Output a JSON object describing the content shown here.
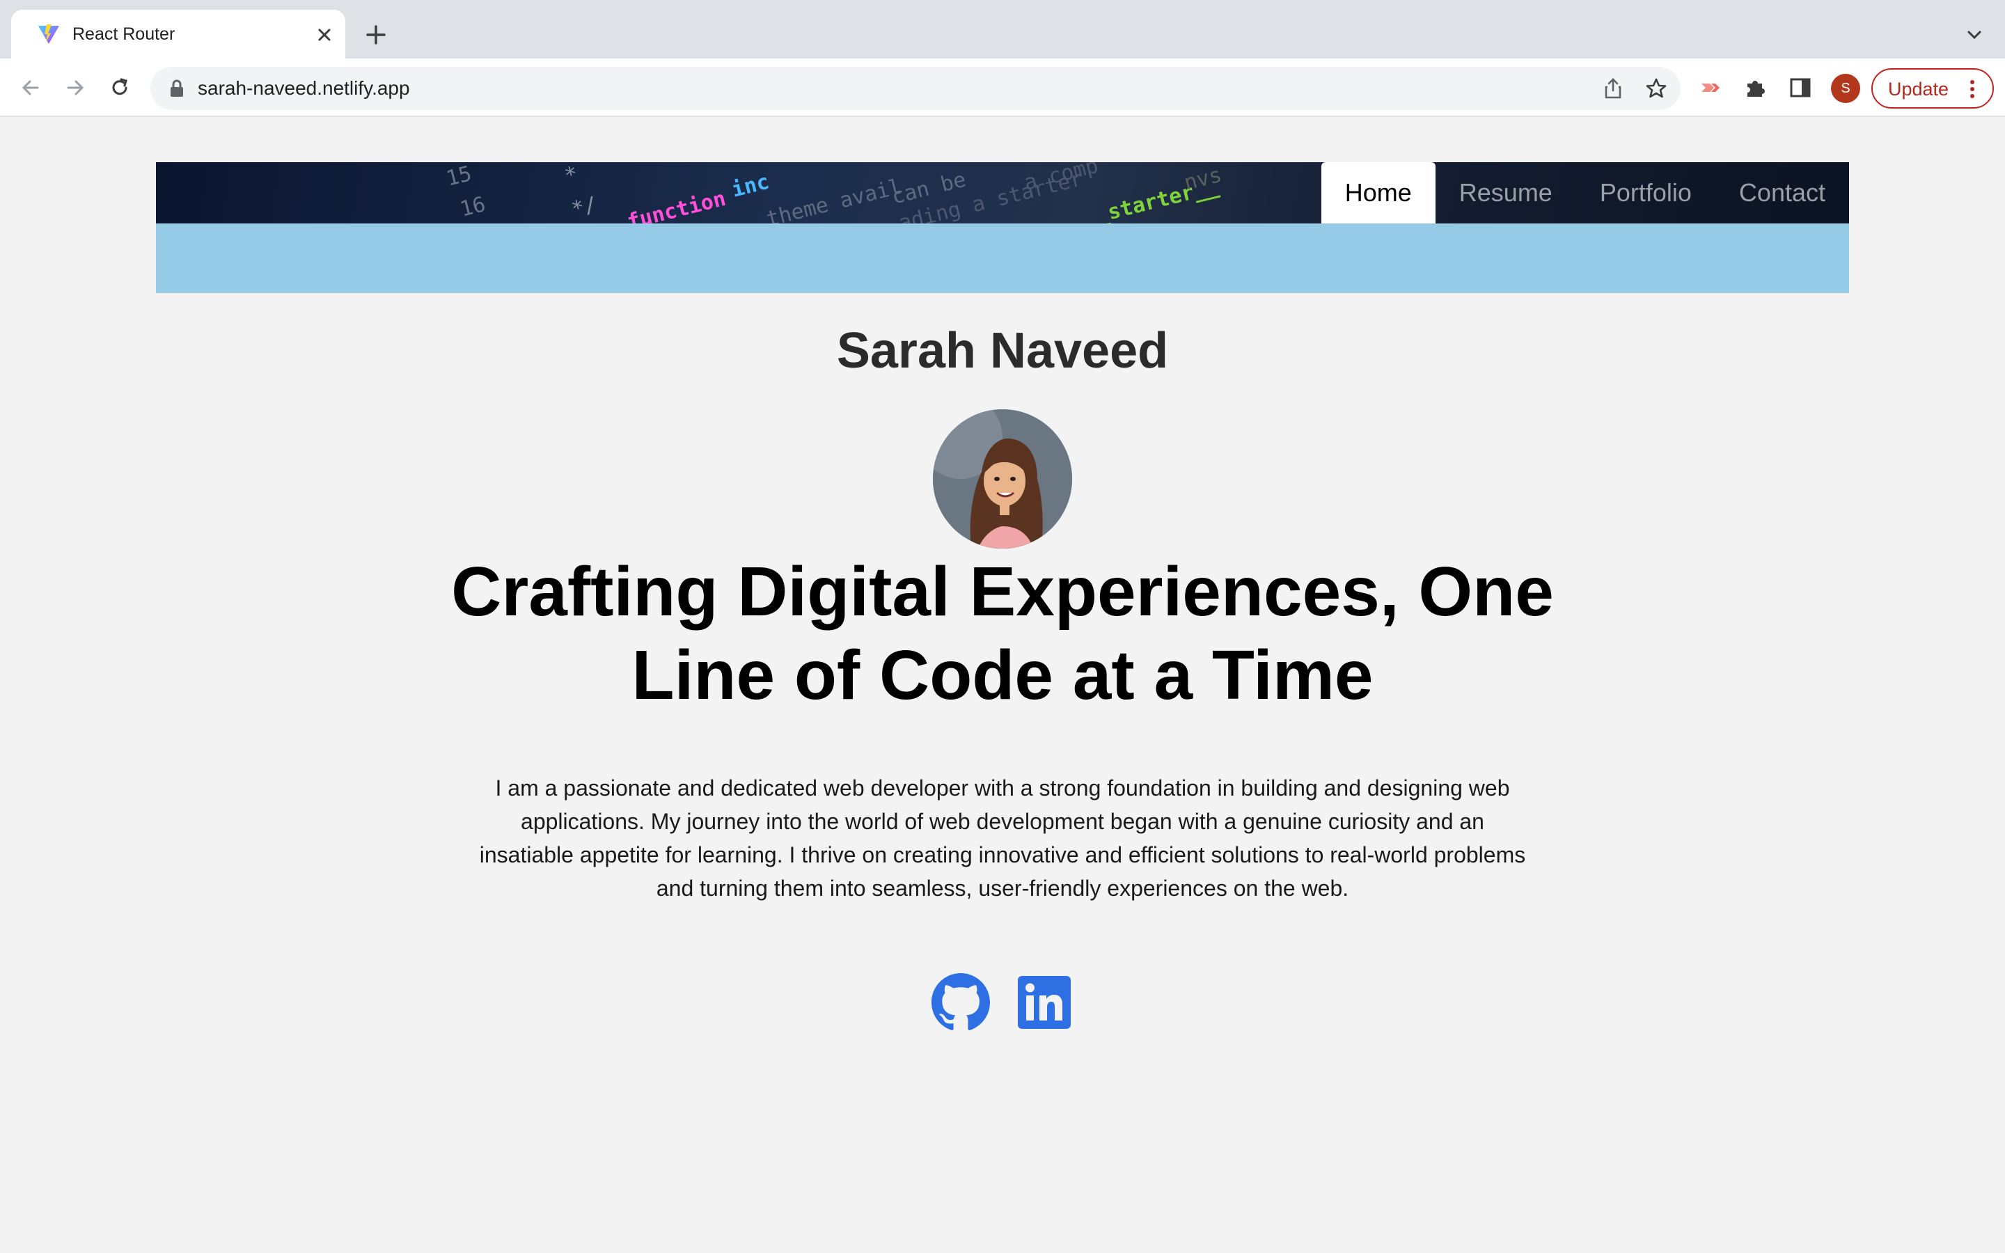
{
  "browser": {
    "tab_title": "React Router",
    "url": "sarah-naveed.netlify.app",
    "profile_initial": "S",
    "update_label": "Update"
  },
  "nav": {
    "items": [
      "Home",
      "Resume",
      "Portfolio",
      "Contact"
    ],
    "active": "Home"
  },
  "hero": {
    "name": "Sarah Naveed",
    "headline": "Crafting Digital Experiences, One Line of Code at a Time",
    "bio": "I am a passionate and dedicated web developer with a strong foundation in building and designing web applications. My journey into the world of web development began with a genuine curiosity and an insatiable appetite for learning. I thrive on creating innovative and efficient solutions to real-world problems and turning them into seamless, user-friendly experiences on the web."
  },
  "social": [
    {
      "icon": "github-icon"
    },
    {
      "icon": "linkedin-icon"
    }
  ],
  "colors": {
    "page_bg": "#f3f3f3",
    "subbar": "#96cbe8",
    "social_icon": "#2f6fe4",
    "update_accent": "#c5221f"
  }
}
